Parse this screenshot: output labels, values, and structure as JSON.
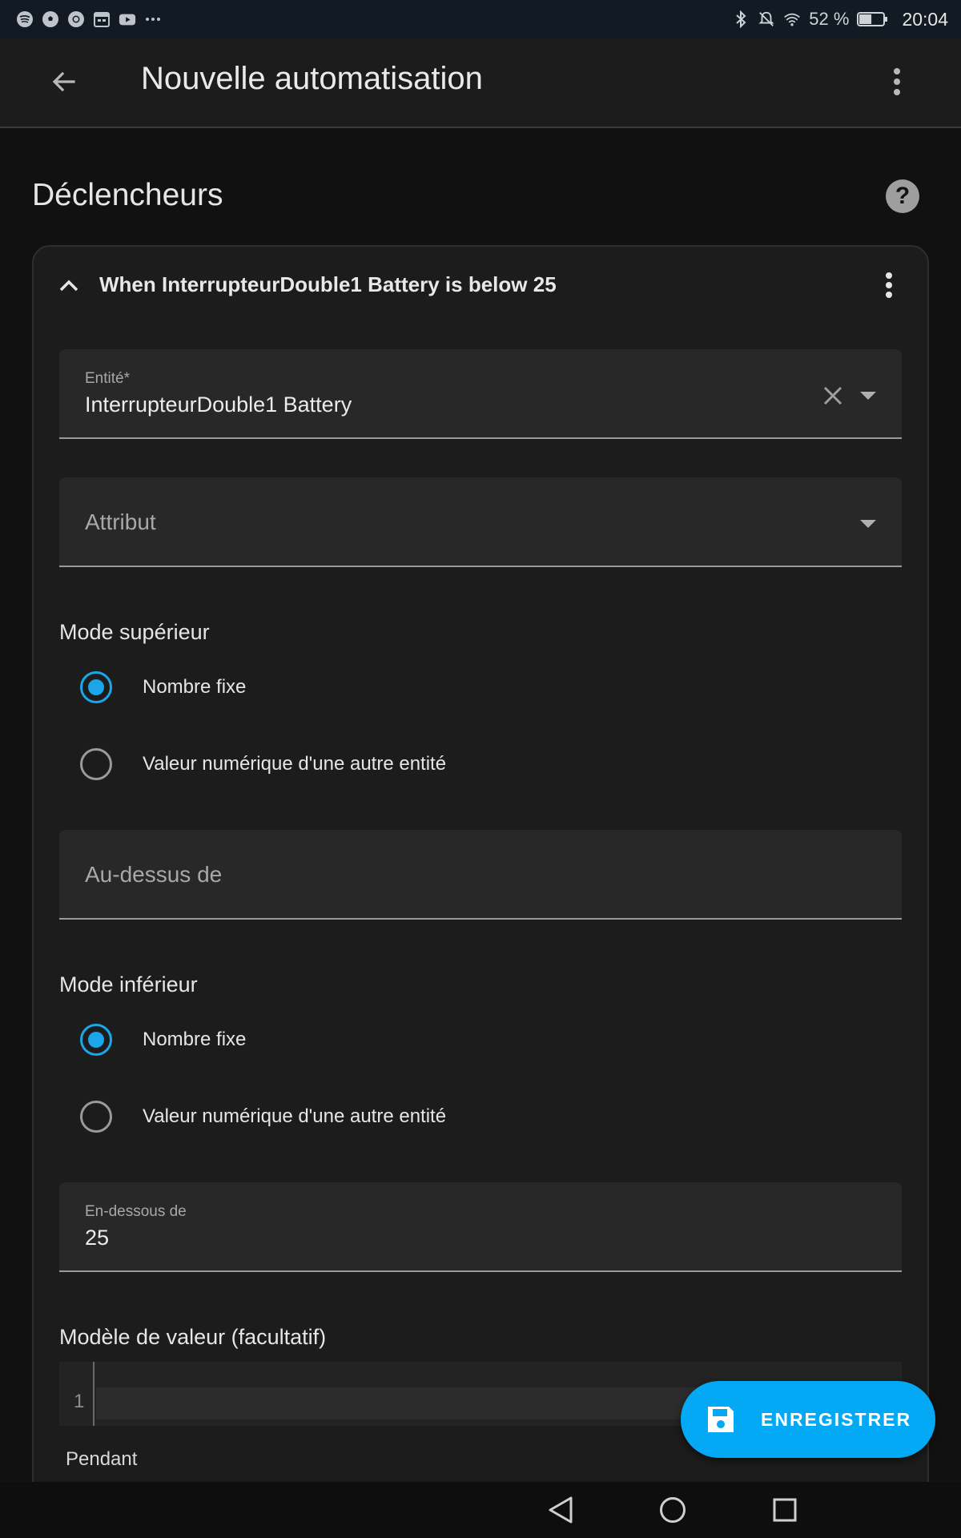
{
  "status_bar": {
    "battery_percent_label": "52 %",
    "battery_level": 0.52,
    "time": "20:04",
    "notification_icons": [
      "spotify-icon",
      "soccer-ball-icon",
      "chrome-icon",
      "calendar-icon",
      "youtube-icon",
      "more-horiz-icon"
    ],
    "system_icons": [
      "bluetooth-icon",
      "mute-icon",
      "wifi-icon",
      "battery-icon"
    ]
  },
  "app_bar": {
    "title": "Nouvelle automatisation"
  },
  "section": {
    "title": "Déclencheurs"
  },
  "trigger_card": {
    "title": "When InterrupteurDouble1 Battery is below 25",
    "entity_field": {
      "label": "Entité*",
      "value": "InterrupteurDouble1 Battery"
    },
    "attribute_field": {
      "placeholder": "Attribut"
    },
    "upper_mode": {
      "label": "Mode supérieur",
      "options": [
        "Nombre fixe",
        "Valeur numérique d'une autre entité"
      ],
      "selected": "Nombre fixe"
    },
    "above_field": {
      "placeholder": "Au-dessus de"
    },
    "lower_mode": {
      "label": "Mode inférieur",
      "options": [
        "Nombre fixe",
        "Valeur numérique d'une autre entité"
      ],
      "selected": "Nombre fixe"
    },
    "below_field": {
      "label": "En-dessous de",
      "value": "25"
    },
    "value_template": {
      "label": "Modèle de valeur (facultatif)",
      "line_number": "1"
    },
    "cutoff_text": "Pendant"
  },
  "fab": {
    "label": "ENREGISTRER"
  },
  "colors": {
    "accent": "#03a9f4",
    "radio_checked": "#1aa6e8",
    "background": "#111111",
    "card": "#1c1c1c",
    "field": "#282828"
  }
}
